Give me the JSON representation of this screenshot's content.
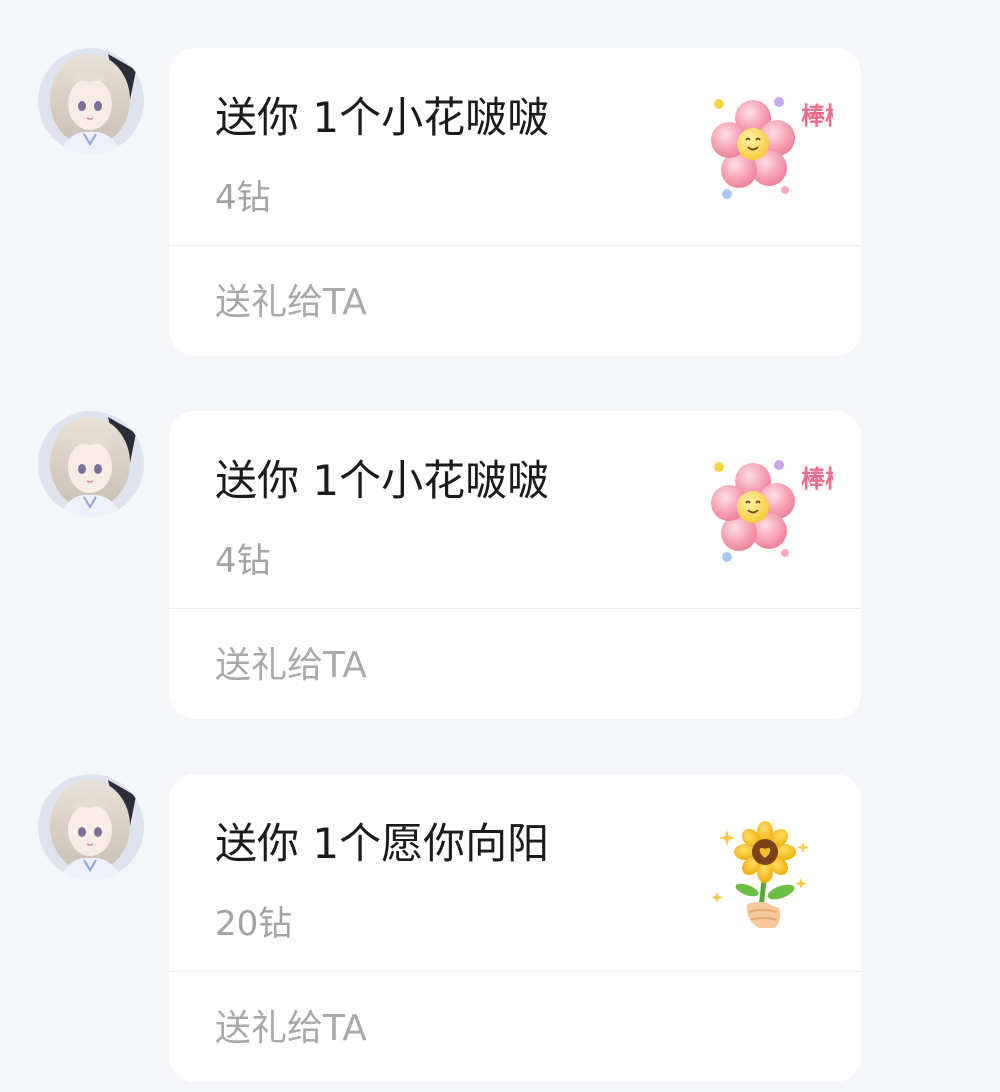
{
  "messages": [
    {
      "gift_title": "送你 1个小花啵啵",
      "gift_price": "4钻",
      "send_label": "送礼给TA",
      "gift_icon": "pink-flower-sticker-icon",
      "sticker_text": "棒棒!"
    },
    {
      "gift_title": "送你 1个小花啵啵",
      "gift_price": "4钻",
      "send_label": "送礼给TA",
      "gift_icon": "pink-flower-sticker-icon",
      "sticker_text": "棒棒!"
    },
    {
      "gift_title": "送你 1个愿你向阳",
      "gift_price": "20钻",
      "send_label": "送礼给TA",
      "gift_icon": "sunflower-in-hand-icon"
    }
  ],
  "colors": {
    "page_background": "#f4f6fa",
    "card_background": "#ffffff",
    "title_text": "#1b1b1b",
    "secondary_text": "#a3a3a3",
    "flower_pink": "#f7a4b6",
    "sunflower_yellow": "#f7c21b"
  }
}
